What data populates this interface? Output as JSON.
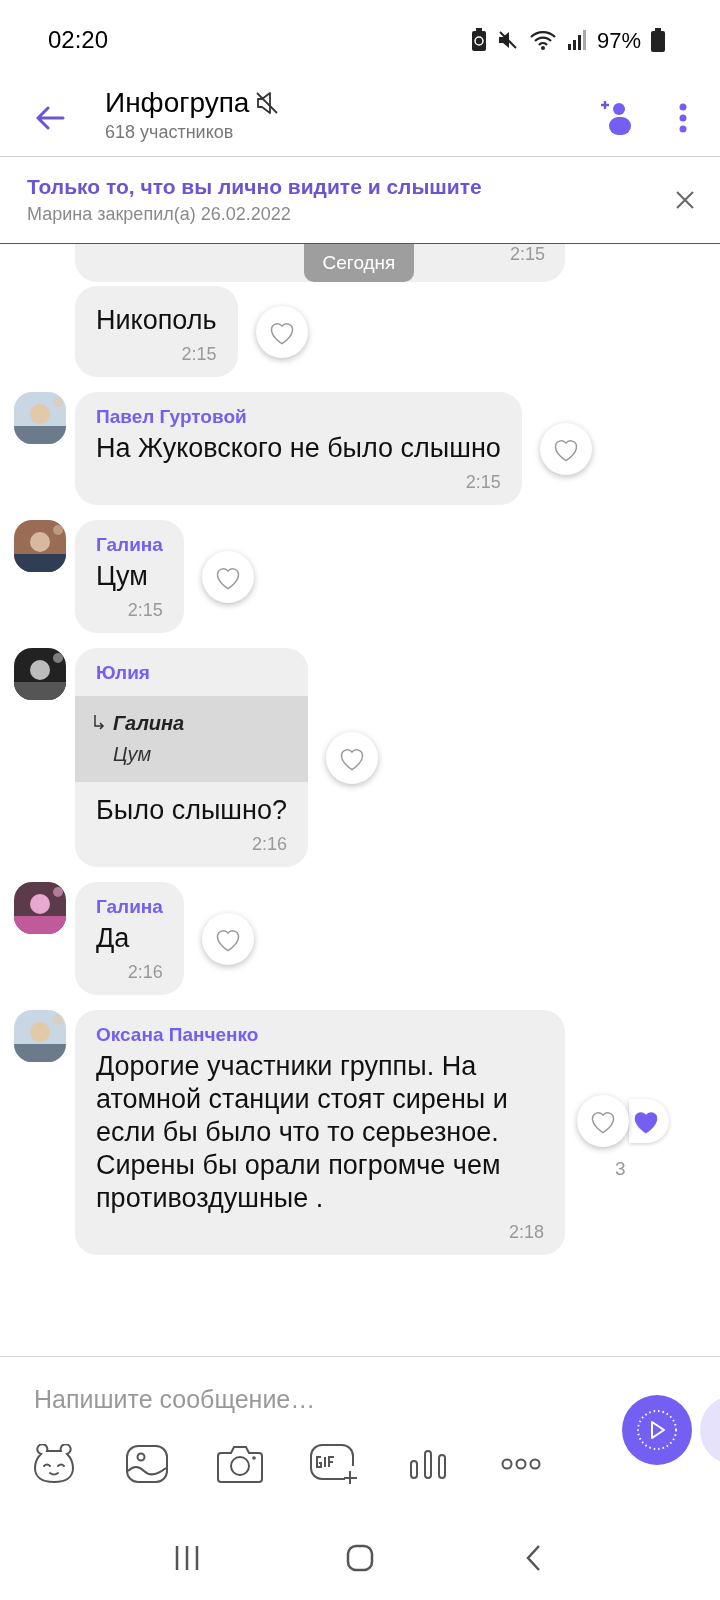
{
  "status_bar": {
    "time": "02:20",
    "battery": "97%"
  },
  "header": {
    "title": "Инфогрупа",
    "muted": true,
    "subtitle": "618 участников"
  },
  "pinned": {
    "text": "Только то, что вы лично видите и слышите",
    "meta": "Марина закрепил(а) 26.02.2022"
  },
  "date_pill": "Сегодня",
  "messages": [
    {
      "kind": "partial",
      "time": "2:15"
    },
    {
      "kind": "text",
      "text": "Никополь",
      "time": "2:15"
    },
    {
      "kind": "text",
      "sender": "Павел Гуртовой",
      "text": "На Жуковского не было слышно",
      "time": "2:15"
    },
    {
      "kind": "text",
      "sender": "Галина",
      "text": "Цум",
      "time": "2:15"
    },
    {
      "kind": "text",
      "sender": "Юлия",
      "reply": {
        "name": "Галина",
        "text": "Цум"
      },
      "text": "Было слышно?",
      "time": "2:16"
    },
    {
      "kind": "text",
      "sender": "Галина",
      "text": "Да",
      "time": "2:16"
    },
    {
      "kind": "text",
      "sender": "Оксана Панченко",
      "text": "Дорогие участники группы. На атомной станции стоят сирены и если бы было что то серьезное. Сирены бы орали погромче чем противоздушные .",
      "time": "2:18",
      "reactions": {
        "count": "3"
      }
    }
  ],
  "composer": {
    "placeholder": "Напишите сообщение…"
  }
}
